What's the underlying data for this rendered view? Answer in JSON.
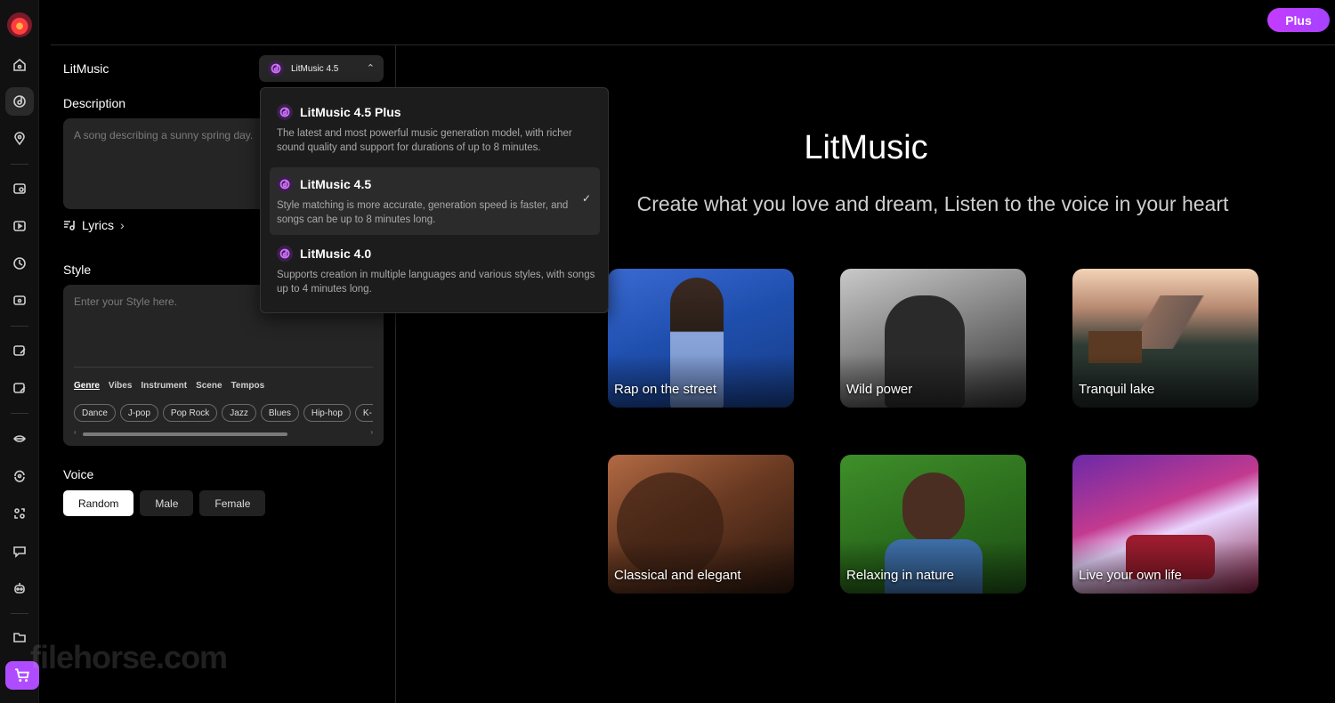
{
  "header": {
    "plus_label": "Plus"
  },
  "panel": {
    "model_label": "LitMusic",
    "model_selected": "LitMusic 4.5",
    "description_label": "Description",
    "description_placeholder": "A song describing a sunny spring day.",
    "lyrics_label": "Lyrics",
    "style_label": "Style",
    "style_placeholder": "Enter your Style here.",
    "style_tabs": [
      "Genre",
      "Vibes",
      "Instrument",
      "Scene",
      "Tempos"
    ],
    "style_chips": [
      "Dance",
      "J-pop",
      "Pop Rock",
      "Jazz",
      "Blues",
      "Hip-hop",
      "K-"
    ],
    "voice_label": "Voice",
    "voice_options": [
      "Random",
      "Male",
      "Female"
    ]
  },
  "dropdown": {
    "options": [
      {
        "title": "LitMusic 4.5 Plus",
        "desc": "The latest and most powerful music generation model, with richer sound quality and support for durations of up to 8 minutes."
      },
      {
        "title": "LitMusic 4.5",
        "desc": "Style matching is more accurate, generation speed is faster, and songs can be up to 8 minutes long."
      },
      {
        "title": "LitMusic 4.0",
        "desc": "Supports creation in multiple languages and various styles, with songs up to 4 minutes long."
      }
    ]
  },
  "main": {
    "title": "LitMusic",
    "subtitle": "Create what you love and dream, Listen to the voice in your heart",
    "cards": [
      "Rap on the street",
      "Wild power",
      "Tranquil lake",
      "Classical and elegant",
      "Relaxing in nature",
      "Live your own life"
    ]
  },
  "watermark": "filehorse.com",
  "colors": {
    "accent": "#b04cff",
    "panel_bg": "#252525",
    "selected_voice": "#ffffff"
  },
  "icons": [
    "home-icon",
    "music-disc-icon",
    "location-pin-icon",
    "image-music-icon",
    "video-music-icon",
    "history-icon",
    "chat-music-icon",
    "edit-music-icon",
    "photo-edit-icon",
    "lips-icon",
    "refresh-face-icon",
    "people-swap-icon",
    "chat-bubble-icon",
    "robot-icon",
    "folder-icon",
    "cart-icon"
  ]
}
